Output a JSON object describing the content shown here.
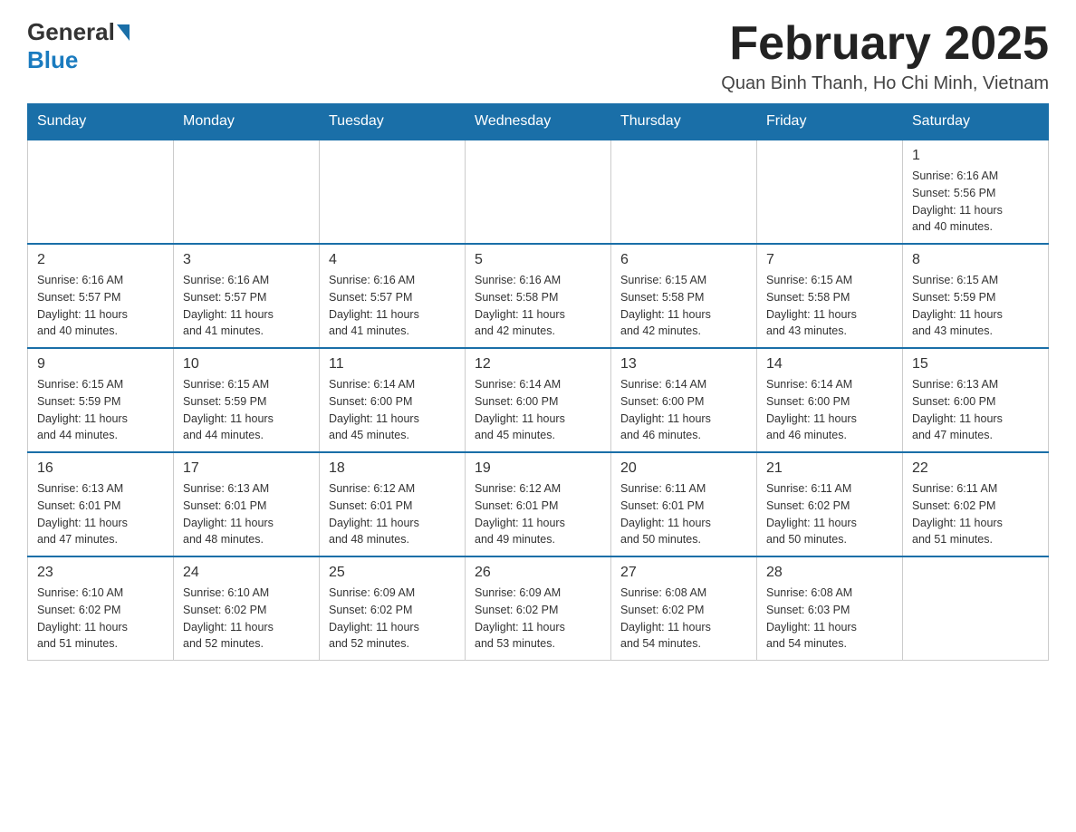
{
  "header": {
    "logo_general": "General",
    "logo_blue": "Blue",
    "title": "February 2025",
    "subtitle": "Quan Binh Thanh, Ho Chi Minh, Vietnam"
  },
  "days_of_week": [
    "Sunday",
    "Monday",
    "Tuesday",
    "Wednesday",
    "Thursday",
    "Friday",
    "Saturday"
  ],
  "weeks": [
    [
      {
        "day": "",
        "info": ""
      },
      {
        "day": "",
        "info": ""
      },
      {
        "day": "",
        "info": ""
      },
      {
        "day": "",
        "info": ""
      },
      {
        "day": "",
        "info": ""
      },
      {
        "day": "",
        "info": ""
      },
      {
        "day": "1",
        "info": "Sunrise: 6:16 AM\nSunset: 5:56 PM\nDaylight: 11 hours\nand 40 minutes."
      }
    ],
    [
      {
        "day": "2",
        "info": "Sunrise: 6:16 AM\nSunset: 5:57 PM\nDaylight: 11 hours\nand 40 minutes."
      },
      {
        "day": "3",
        "info": "Sunrise: 6:16 AM\nSunset: 5:57 PM\nDaylight: 11 hours\nand 41 minutes."
      },
      {
        "day": "4",
        "info": "Sunrise: 6:16 AM\nSunset: 5:57 PM\nDaylight: 11 hours\nand 41 minutes."
      },
      {
        "day": "5",
        "info": "Sunrise: 6:16 AM\nSunset: 5:58 PM\nDaylight: 11 hours\nand 42 minutes."
      },
      {
        "day": "6",
        "info": "Sunrise: 6:15 AM\nSunset: 5:58 PM\nDaylight: 11 hours\nand 42 minutes."
      },
      {
        "day": "7",
        "info": "Sunrise: 6:15 AM\nSunset: 5:58 PM\nDaylight: 11 hours\nand 43 minutes."
      },
      {
        "day": "8",
        "info": "Sunrise: 6:15 AM\nSunset: 5:59 PM\nDaylight: 11 hours\nand 43 minutes."
      }
    ],
    [
      {
        "day": "9",
        "info": "Sunrise: 6:15 AM\nSunset: 5:59 PM\nDaylight: 11 hours\nand 44 minutes."
      },
      {
        "day": "10",
        "info": "Sunrise: 6:15 AM\nSunset: 5:59 PM\nDaylight: 11 hours\nand 44 minutes."
      },
      {
        "day": "11",
        "info": "Sunrise: 6:14 AM\nSunset: 6:00 PM\nDaylight: 11 hours\nand 45 minutes."
      },
      {
        "day": "12",
        "info": "Sunrise: 6:14 AM\nSunset: 6:00 PM\nDaylight: 11 hours\nand 45 minutes."
      },
      {
        "day": "13",
        "info": "Sunrise: 6:14 AM\nSunset: 6:00 PM\nDaylight: 11 hours\nand 46 minutes."
      },
      {
        "day": "14",
        "info": "Sunrise: 6:14 AM\nSunset: 6:00 PM\nDaylight: 11 hours\nand 46 minutes."
      },
      {
        "day": "15",
        "info": "Sunrise: 6:13 AM\nSunset: 6:00 PM\nDaylight: 11 hours\nand 47 minutes."
      }
    ],
    [
      {
        "day": "16",
        "info": "Sunrise: 6:13 AM\nSunset: 6:01 PM\nDaylight: 11 hours\nand 47 minutes."
      },
      {
        "day": "17",
        "info": "Sunrise: 6:13 AM\nSunset: 6:01 PM\nDaylight: 11 hours\nand 48 minutes."
      },
      {
        "day": "18",
        "info": "Sunrise: 6:12 AM\nSunset: 6:01 PM\nDaylight: 11 hours\nand 48 minutes."
      },
      {
        "day": "19",
        "info": "Sunrise: 6:12 AM\nSunset: 6:01 PM\nDaylight: 11 hours\nand 49 minutes."
      },
      {
        "day": "20",
        "info": "Sunrise: 6:11 AM\nSunset: 6:01 PM\nDaylight: 11 hours\nand 50 minutes."
      },
      {
        "day": "21",
        "info": "Sunrise: 6:11 AM\nSunset: 6:02 PM\nDaylight: 11 hours\nand 50 minutes."
      },
      {
        "day": "22",
        "info": "Sunrise: 6:11 AM\nSunset: 6:02 PM\nDaylight: 11 hours\nand 51 minutes."
      }
    ],
    [
      {
        "day": "23",
        "info": "Sunrise: 6:10 AM\nSunset: 6:02 PM\nDaylight: 11 hours\nand 51 minutes."
      },
      {
        "day": "24",
        "info": "Sunrise: 6:10 AM\nSunset: 6:02 PM\nDaylight: 11 hours\nand 52 minutes."
      },
      {
        "day": "25",
        "info": "Sunrise: 6:09 AM\nSunset: 6:02 PM\nDaylight: 11 hours\nand 52 minutes."
      },
      {
        "day": "26",
        "info": "Sunrise: 6:09 AM\nSunset: 6:02 PM\nDaylight: 11 hours\nand 53 minutes."
      },
      {
        "day": "27",
        "info": "Sunrise: 6:08 AM\nSunset: 6:02 PM\nDaylight: 11 hours\nand 54 minutes."
      },
      {
        "day": "28",
        "info": "Sunrise: 6:08 AM\nSunset: 6:03 PM\nDaylight: 11 hours\nand 54 minutes."
      },
      {
        "day": "",
        "info": ""
      }
    ]
  ]
}
